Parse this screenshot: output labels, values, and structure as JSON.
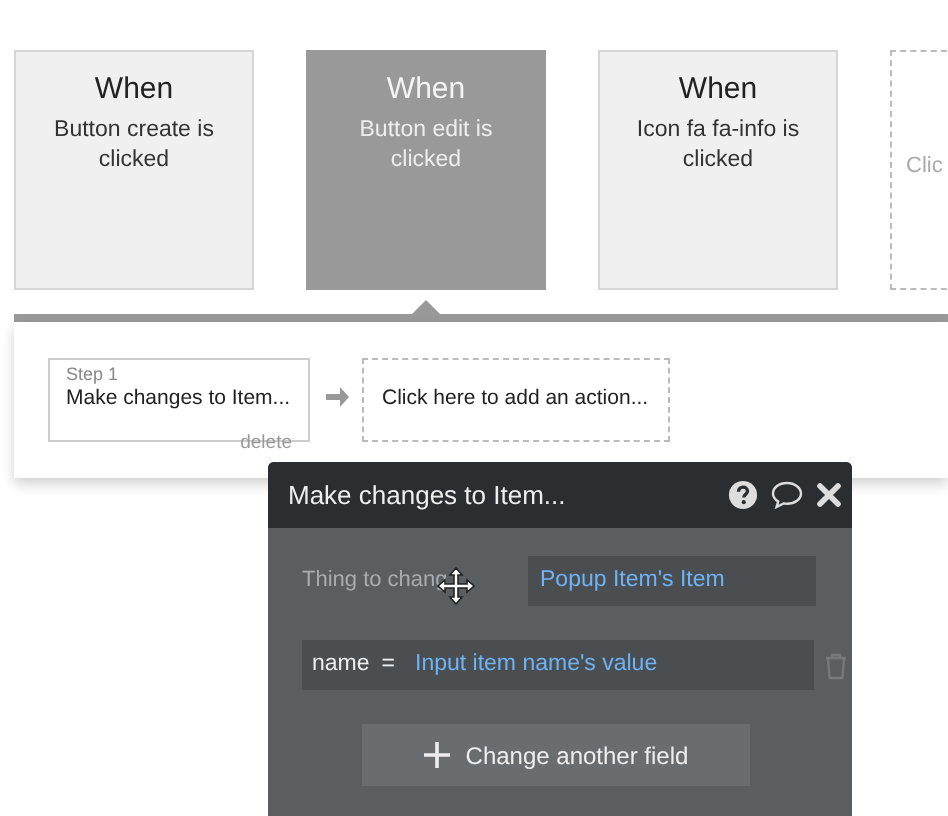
{
  "events": [
    {
      "kind": "event",
      "title": "When",
      "label": "Button create is clicked",
      "selected": false
    },
    {
      "kind": "event",
      "title": "When",
      "label": "Button edit is clicked",
      "selected": true
    },
    {
      "kind": "event",
      "title": "When",
      "label": "Icon fa fa-info is clicked",
      "selected": false
    },
    {
      "kind": "add",
      "label": "Clic"
    }
  ],
  "workflow": {
    "step": {
      "number": "Step 1",
      "name": "Make changes to Item...",
      "delete": "delete"
    },
    "add_action": "Click here to add an action..."
  },
  "popup": {
    "title": "Make changes to Item...",
    "thing_label": "Thing to chang",
    "thing_value": "Popup Item's Item",
    "fields": [
      {
        "name": "name",
        "operator": "=",
        "value": "Input item name's value"
      }
    ],
    "add_button": "Change another field"
  }
}
